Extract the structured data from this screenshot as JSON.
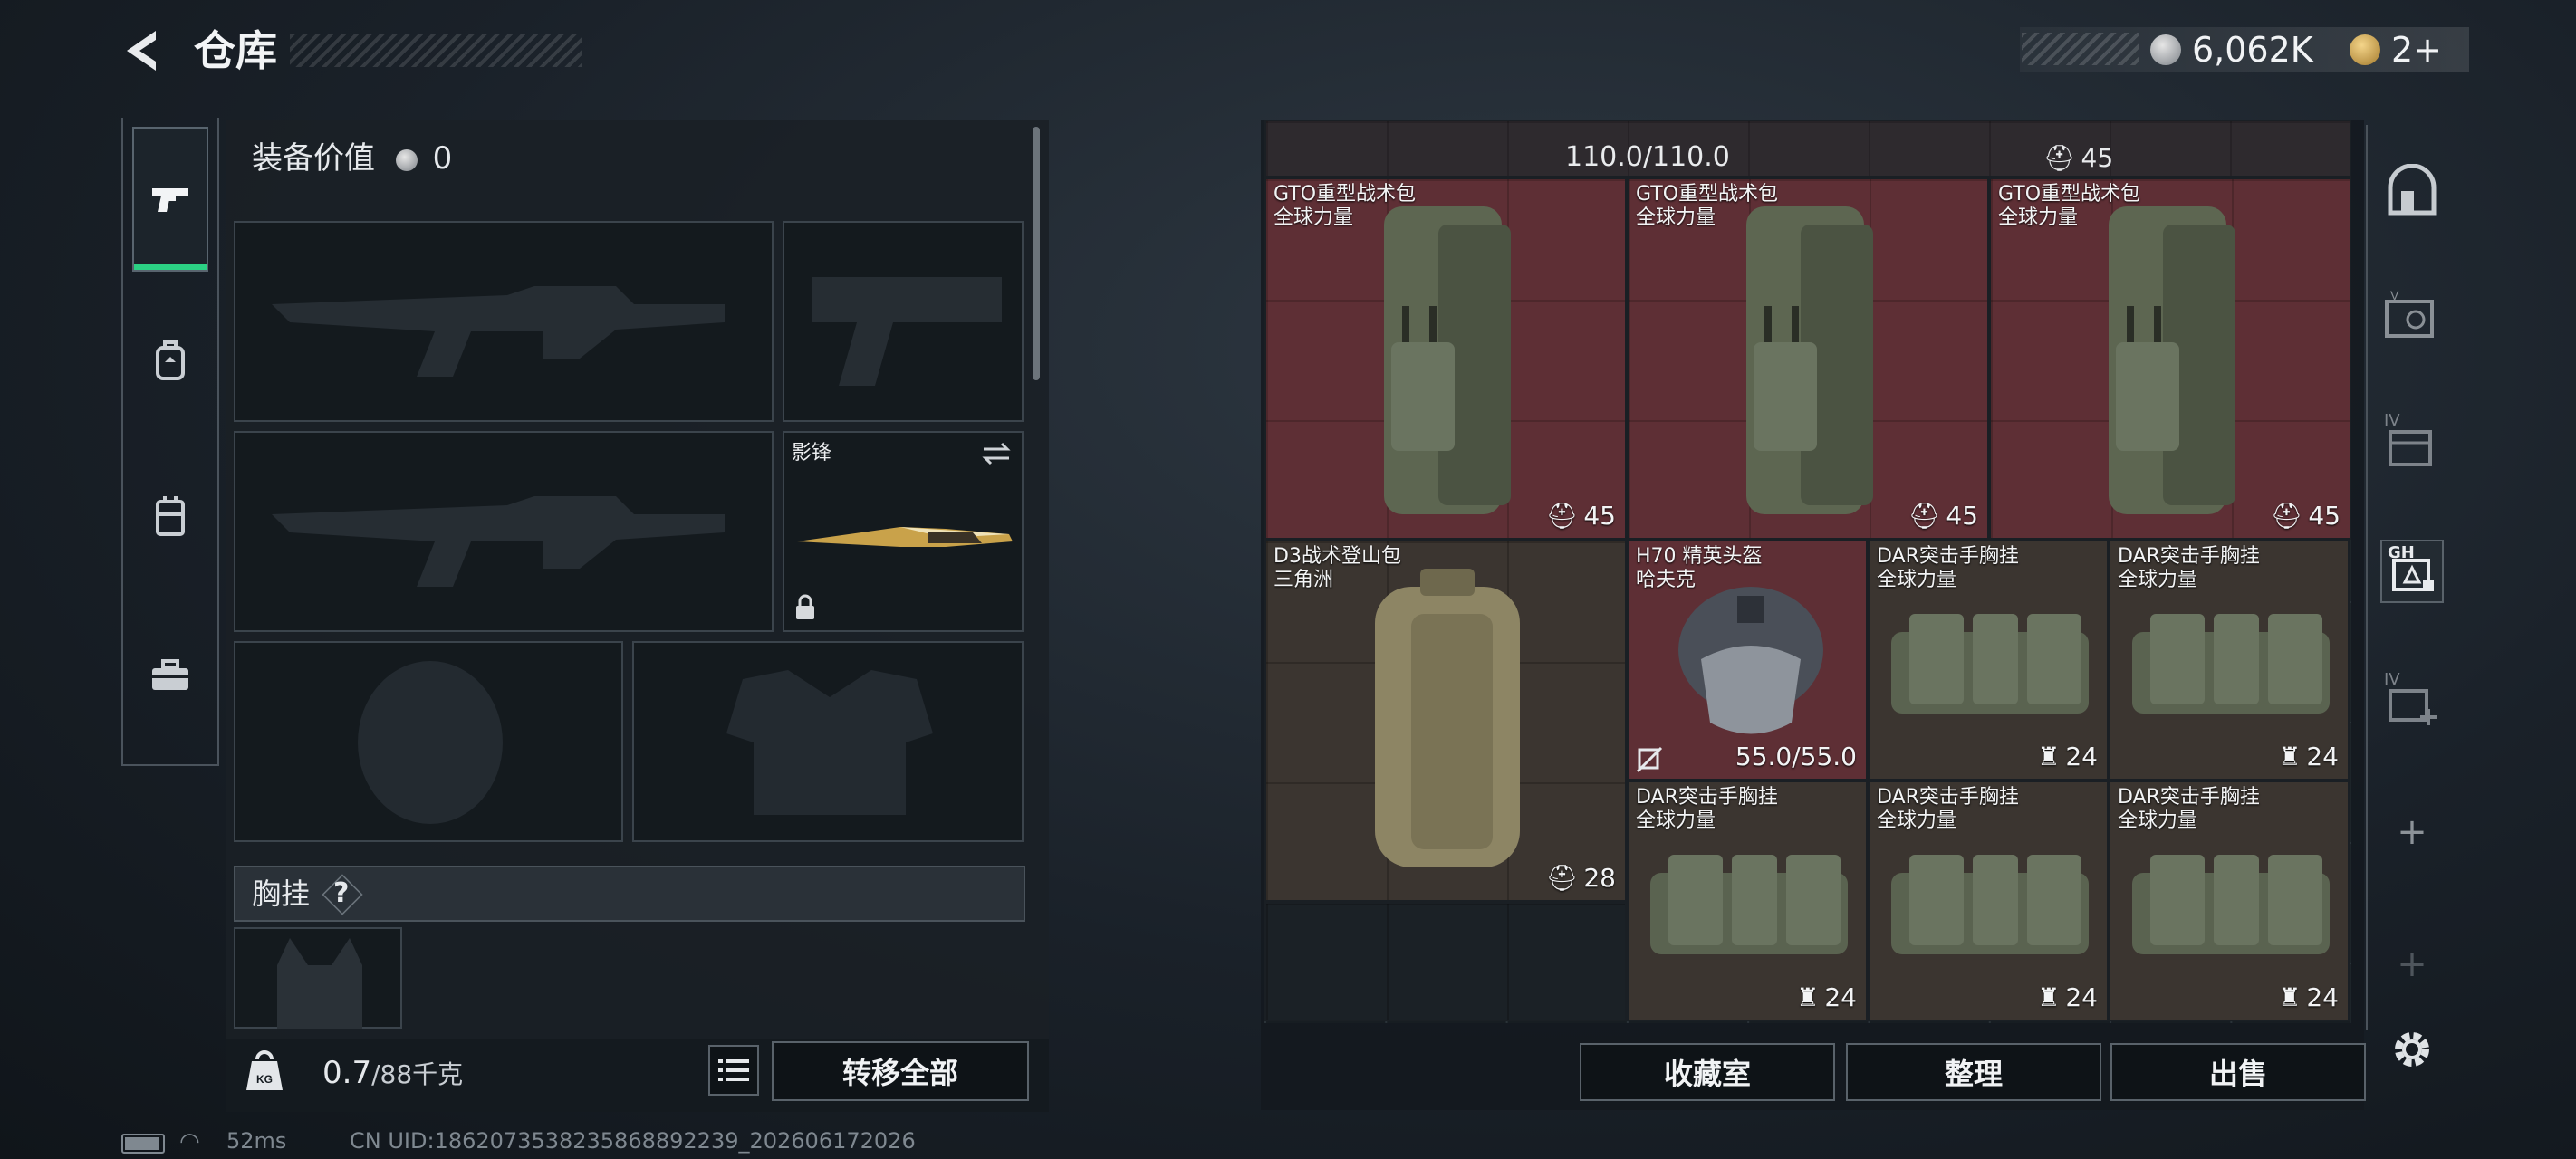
{
  "header": {
    "title": "仓库",
    "currency": {
      "silver": "6,062K",
      "gold": "2+"
    }
  },
  "tabs": [
    {
      "name": "weapon",
      "active": true
    },
    {
      "name": "backpack",
      "active": false
    },
    {
      "name": "chest-rig",
      "active": false
    },
    {
      "name": "toolbox",
      "active": false
    }
  ],
  "equipment": {
    "value_label": "装备价值",
    "value": "0",
    "melee_name": "影锋",
    "chest_label": "胸挂",
    "chest_help": "?",
    "weight_current": "0.7",
    "weight_max": "/88千克",
    "weight_icon_label": "KG",
    "transfer_all": "转移全部"
  },
  "storage": {
    "top_row_durability": "110.0/110.0",
    "top_row_count": "45",
    "items": [
      {
        "line1": "GTO重型战术包",
        "line2": "全球力量",
        "value": "45"
      },
      {
        "line1": "GTO重型战术包",
        "line2": "全球力量",
        "value": "45"
      },
      {
        "line1": "GTO重型战术包",
        "line2": "全球力量",
        "value": "45"
      },
      {
        "line1": "D3战术登山包",
        "line2": "三角洲",
        "value": "28"
      },
      {
        "line1": "H70 精英头盔",
        "line2": "哈夫克",
        "value": "55.0/55.0"
      },
      {
        "line1": "DAR突击手胸挂",
        "line2": "全球力量",
        "value": "24"
      },
      {
        "line1": "DAR突击手胸挂",
        "line2": "全球力量",
        "value": "24"
      },
      {
        "line1": "DAR突击手胸挂",
        "line2": "全球力量",
        "value": "24"
      },
      {
        "line1": "DAR突击手胸挂",
        "line2": "全球力量",
        "value": "24"
      },
      {
        "line1": "DAR突击手胸挂",
        "line2": "全球力量",
        "value": "24"
      }
    ]
  },
  "sidebar": {
    "badge_gh": "GH",
    "badge_iv": "IV",
    "badge_iv2": "IV",
    "add": "+",
    "add_disabled": "+"
  },
  "bottom_buttons": {
    "collection": "收藏室",
    "organize": "整理",
    "sell": "出售"
  },
  "status": {
    "ping": "52ms",
    "uid": "CN UID:1862073538235868892239_202606172026"
  },
  "colors": {
    "accent_green": "#2bd184",
    "cell_red": "#5e2f35",
    "cell_brown": "#3b3530"
  }
}
